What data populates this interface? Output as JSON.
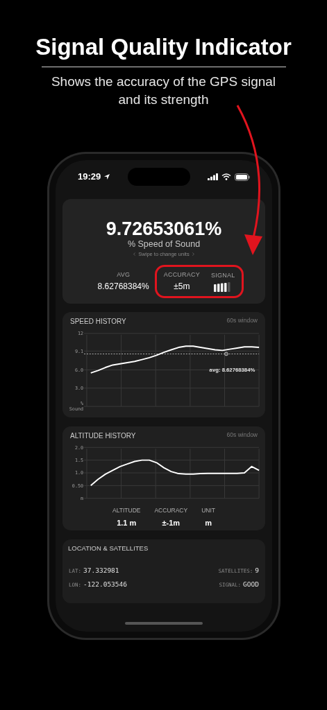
{
  "header": {
    "title": "Signal Quality Indicator",
    "subtitle": "Shows the accuracy of the GPS signal and its strength"
  },
  "status_bar": {
    "time": "19:29"
  },
  "speed_card": {
    "value": "9.72653061%",
    "unit": "% Speed of Sound",
    "hint": "Swipe to change units",
    "stats": [
      {
        "label": "AVG",
        "value": "8.62768384%"
      }
    ],
    "highlighted_stats": [
      {
        "kind": "text",
        "label": "ACCURACY",
        "value": "±5m"
      },
      {
        "kind": "bars",
        "label": "SIGNAL"
      }
    ]
  },
  "speed_history": {
    "title": "SPEED HISTORY",
    "window": "60s window",
    "chart_data": {
      "type": "line",
      "grid": true,
      "ylim": [
        0,
        12
      ],
      "yticks": [
        {
          "value": 0,
          "label": "% Sound"
        },
        {
          "value": 3,
          "label": "3.0"
        },
        {
          "value": 6,
          "label": "6.0"
        },
        {
          "value": 9.1,
          "label": "9.1"
        },
        {
          "value": 12,
          "label": "12"
        }
      ],
      "series": [
        {
          "color": "#ffffff",
          "values": [
            5.5,
            5.9,
            6.4,
            6.8,
            7.0,
            7.2,
            7.4,
            7.7,
            8.0,
            8.4,
            8.9,
            9.3,
            9.7,
            9.9,
            9.9,
            9.7,
            9.5,
            9.3,
            9.2,
            9.4,
            9.6,
            9.8,
            9.8,
            9.7
          ]
        }
      ],
      "ref_lines": [
        {
          "axis": "y",
          "value": 8.63,
          "color": "#bbbbbb"
        }
      ],
      "annotations": [
        "avg: 8.62768384%"
      ]
    }
  },
  "altitude_history": {
    "title": "ALTITUDE HISTORY",
    "window": "60s window",
    "chart_data": {
      "type": "line",
      "grid": true,
      "ylim": [
        0,
        2
      ],
      "yticks": [
        {
          "value": 0,
          "label": "m"
        },
        {
          "value": 0.5,
          "label": "0.50"
        },
        {
          "value": 1,
          "label": "1.0"
        },
        {
          "value": 1.5,
          "label": "1.5"
        },
        {
          "value": 2,
          "label": "2.0"
        }
      ],
      "series": [
        {
          "color": "#ffffff",
          "values": [
            0.5,
            0.75,
            0.95,
            1.1,
            1.25,
            1.35,
            1.45,
            1.5,
            1.5,
            1.4,
            1.2,
            1.05,
            0.97,
            0.95,
            0.95,
            0.97,
            0.98,
            0.98,
            0.98,
            0.98,
            0.98,
            1.0,
            1.25,
            1.1
          ]
        }
      ]
    },
    "readings": [
      {
        "label": "ALTITUDE",
        "value": "1.1 m"
      },
      {
        "label": "ACCURACY",
        "value": "±-1m"
      },
      {
        "label": "UNIT",
        "value": "m"
      }
    ]
  },
  "location": {
    "title": "LOCATION & SATELLITES",
    "left": [
      {
        "label": "LAT:",
        "value": "37.332981"
      },
      {
        "label": "LON:",
        "value": "-122.053546"
      }
    ],
    "right": [
      {
        "label": "SATELLITES:",
        "value": "9"
      },
      {
        "label": "SIGNAL:",
        "value": "GOOD"
      }
    ]
  }
}
